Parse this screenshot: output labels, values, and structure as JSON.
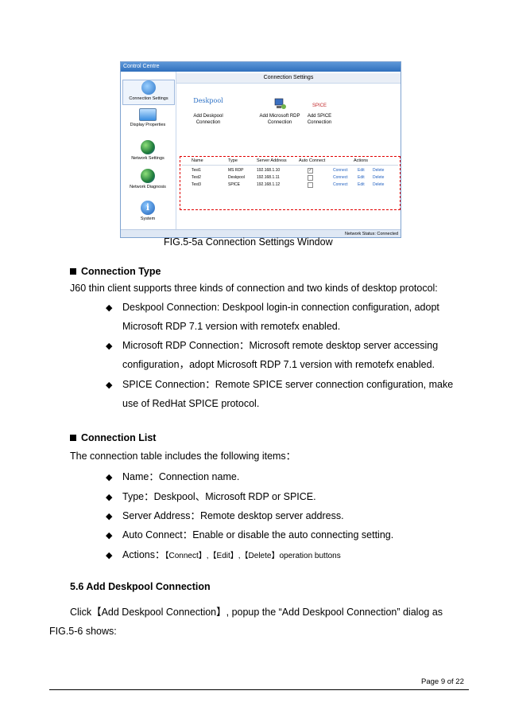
{
  "window": {
    "title": "Control Centre",
    "content_title": "Connection Settings",
    "sidebar": [
      {
        "label": "Connection Settings",
        "icon": "connection-settings-icon"
      },
      {
        "label": "Display Properties",
        "icon": "display-icon"
      },
      {
        "label": "Network Settings",
        "icon": "network-globe-icon"
      },
      {
        "label": "Network Diagnosis",
        "icon": "diagnosis-globe-icon"
      },
      {
        "label": "System",
        "icon": "info-icon"
      }
    ],
    "add_buttons": [
      {
        "logo": "Deskpool",
        "label": "Add Deskpool Connection"
      },
      {
        "logo": "",
        "label": "Add Microsoft RDP Connection"
      },
      {
        "logo": "SPICE",
        "label": "Add SPICE Connection"
      }
    ],
    "table": {
      "headers": [
        "Name",
        "Type",
        "Server Address",
        "Auto Connect",
        "Actions"
      ],
      "rows": [
        {
          "name": "Test1",
          "type": "MS RDP",
          "address": "192.168.1.10",
          "auto": true
        },
        {
          "name": "Test2",
          "type": "Deskpool",
          "address": "192.168.1.11",
          "auto": false
        },
        {
          "name": "Test3",
          "type": "SPICE",
          "address": "192.168.1.12",
          "auto": false
        }
      ],
      "actions": [
        "Connect",
        "Edit",
        "Delete"
      ]
    },
    "status": "Network Status: Connected"
  },
  "doc": {
    "caption": "FIG.5-5a Connection Settings Window",
    "sec1_title": "Connection Type",
    "sec1_intro": "J60 thin client supports three kinds of connection and two kinds of desktop protocol:",
    "sec1_b1_l1": "Deskpool Connection: Deskpool login-in connection configuration, adopt",
    "sec1_b1_l2": "Microsoft RDP 7.1 version with remotefx enabled.",
    "sec1_b2_l1": "Microsoft RDP Connection：Microsoft remote desktop server accessing",
    "sec1_b2_l2": "configuration，adopt Microsoft RDP 7.1 version with remotefx enabled.",
    "sec1_b3_l1": "SPICE Connection：Remote SPICE server connection configuration, make",
    "sec1_b3_l2": "use of RedHat SPICE protocol.",
    "sec2_title": "Connection List",
    "sec2_intro": "The connection table includes the following items：",
    "sec2_b1": "Name：Connection name.",
    "sec2_b2": "Type：Deskpool、Microsoft RDP or SPICE.",
    "sec2_b3": "Server Address：Remote desktop server address.",
    "sec2_b4": "Auto Connect：Enable or disable the auto connecting setting.",
    "sec2_b5_lead": "Actions：",
    "sec2_b5_rest": "【Connect】,【Edit】,【Delete】operation buttons",
    "sec3_title": "5.6   Add Deskpool Connection",
    "sec3_l1": "Click【Add Deskpool Connection】, popup the “Add Deskpool Connection” dialog as",
    "sec3_l2": "FIG.5-6 shows:",
    "page": "Page 9 of 22"
  }
}
